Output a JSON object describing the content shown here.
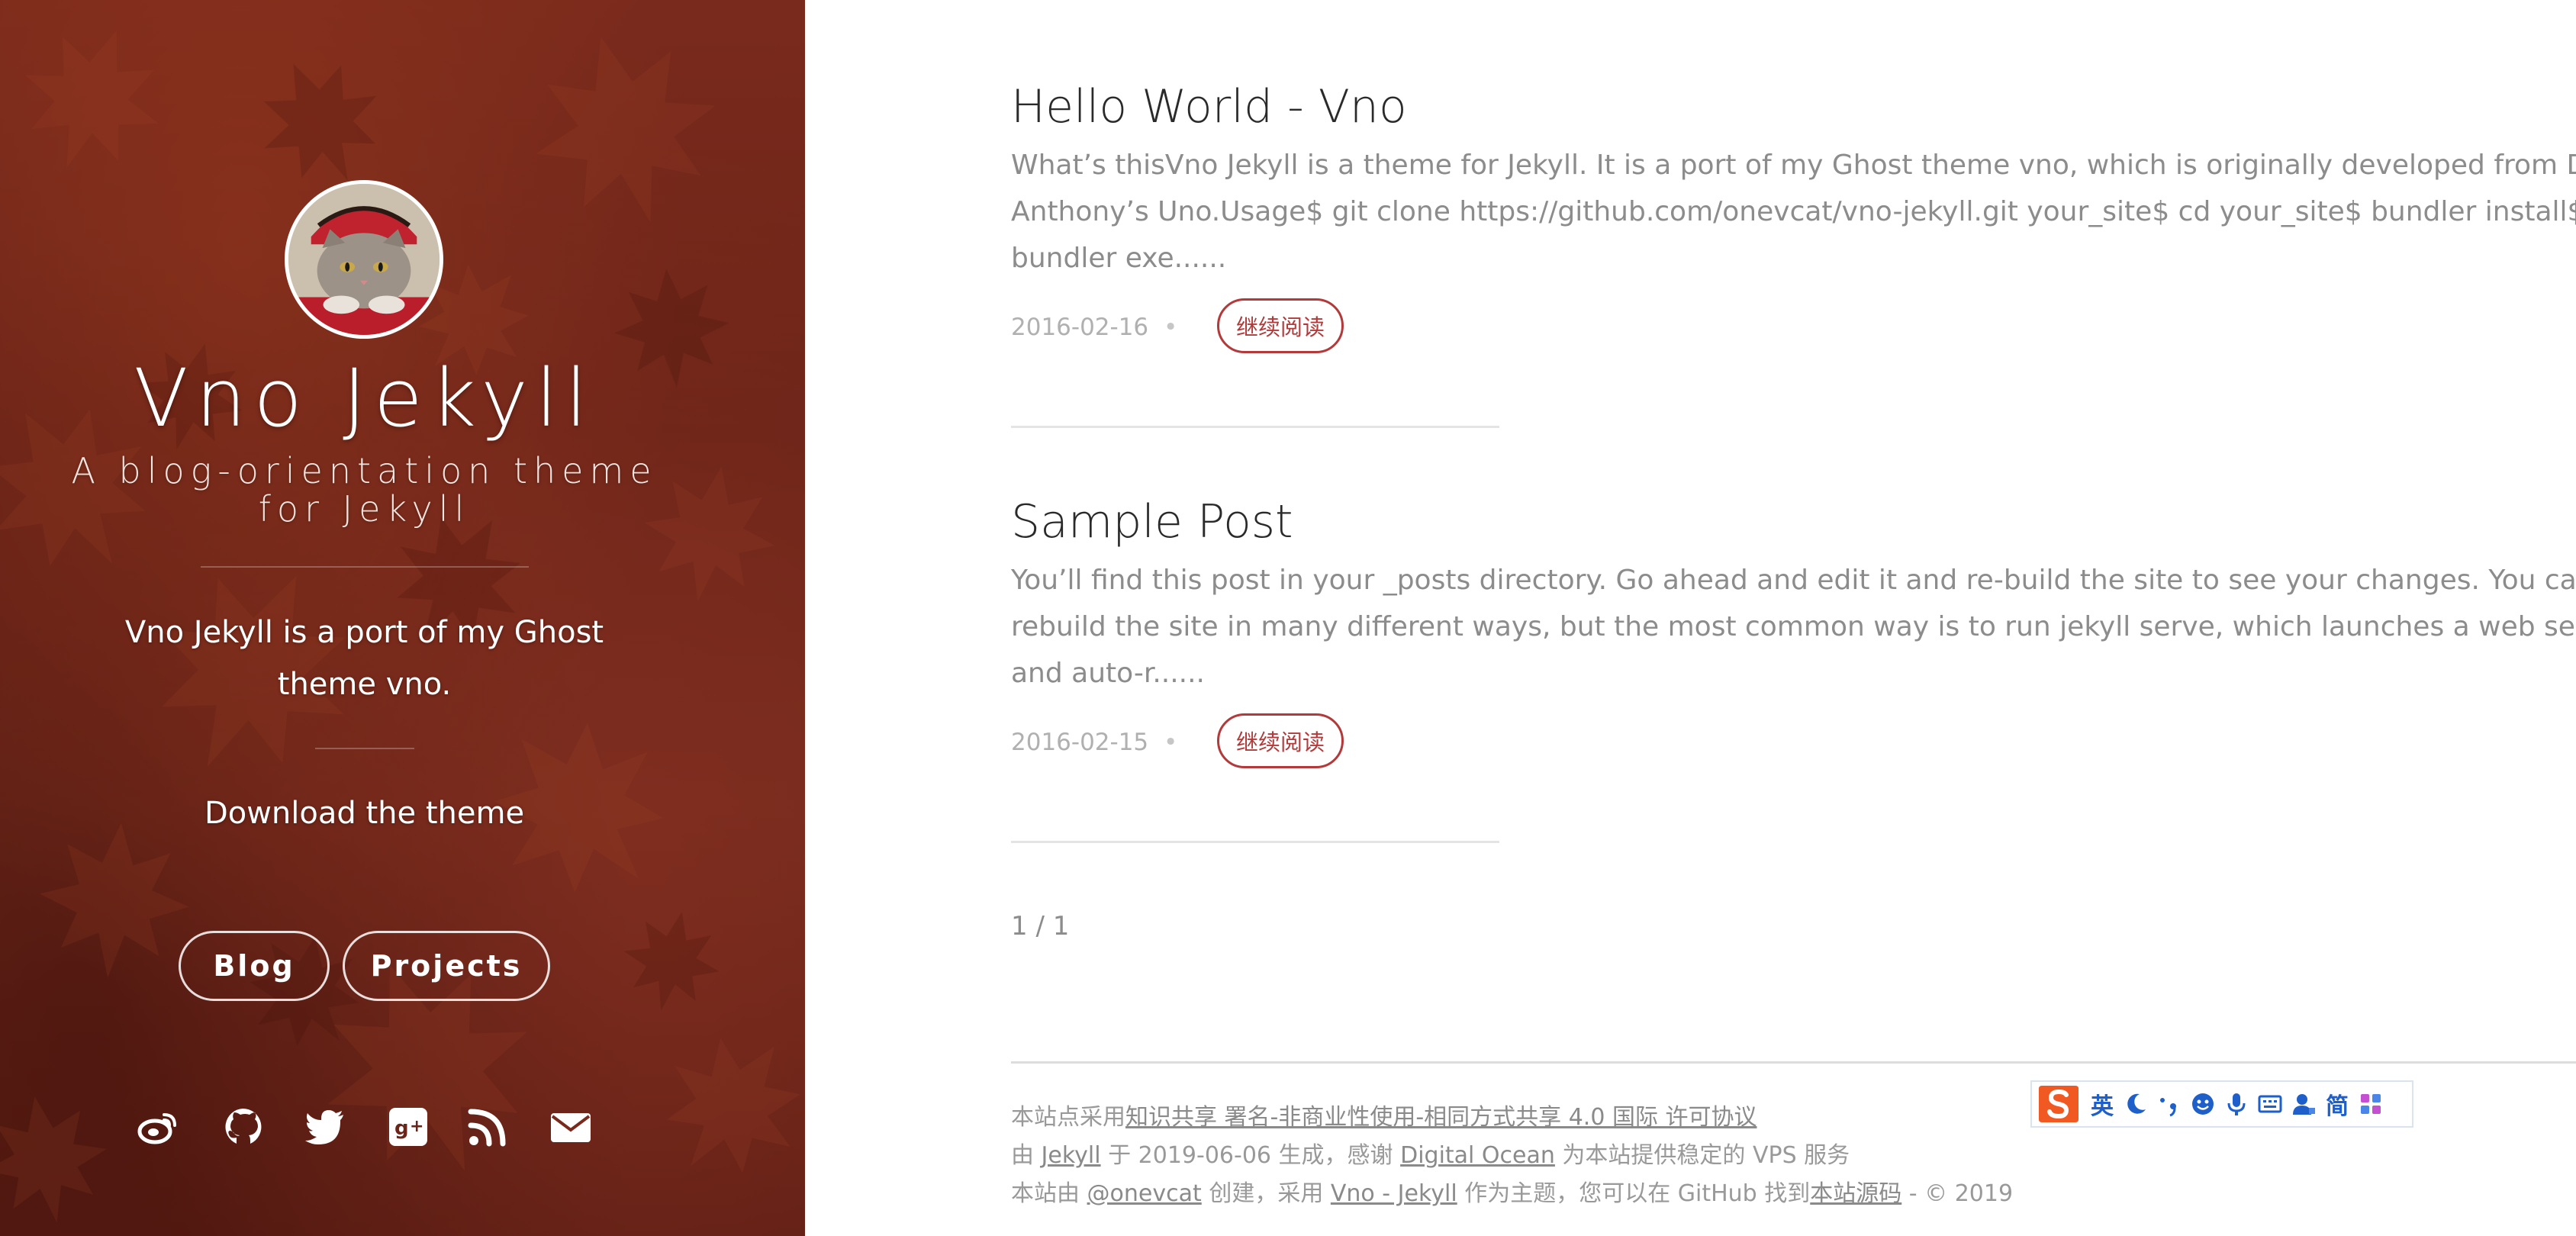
{
  "sidebar": {
    "title": "Vno Jekyll",
    "subtitle": "A blog-orientation theme for Jekyll",
    "description": "Vno Jekyll is a port of my Ghost theme vno.",
    "download_label": "Download the theme",
    "nav": [
      {
        "label": "Blog"
      },
      {
        "label": "Projects"
      }
    ],
    "social_icons": [
      "weibo-icon",
      "github-icon",
      "twitter-icon",
      "google-plus-icon",
      "rss-icon",
      "email-icon"
    ]
  },
  "posts": [
    {
      "title": "Hello World - Vno",
      "excerpt": "What’s thisVno Jekyll is a theme for Jekyll. It is a port of my Ghost theme vno, which is originally developed from Dale Anthony’s Uno.Usage$ git clone https://github.com/onevcat/vno-jekyll.git your_site$ cd your_site$ bundler install$ bundler exe......",
      "date": "2016-02-16",
      "read_more": "继续阅读"
    },
    {
      "title": "Sample Post",
      "excerpt": "You’ll find this post in your _posts directory. Go ahead and edit it and re-build the site to see your changes. You can rebuild the site in many different ways, but the most common way is to run jekyll serve, which launches a web server and auto-r......",
      "date": "2016-02-15",
      "read_more": "继续阅读"
    }
  ],
  "pagination": "1 / 1",
  "footer": {
    "line1_prefix": "本站点采用",
    "line1_link": "知识共享 署名-非商业性使用-相同方式共享 4.0 国际 许可协议",
    "line2_prefix": "由 ",
    "line2_link1": "Jekyll",
    "line2_mid": " 于 2019-06-06 生成，感谢 ",
    "line2_link2": "Digital Ocean",
    "line2_suffix": " 为本站提供稳定的 VPS 服务",
    "line3_prefix": "本站由 ",
    "line3_link1": "@onevcat",
    "line3_mid": " 创建，采用 ",
    "line3_link2": "Vno - Jekyll",
    "line3_mid2": " 作为主题，您可以在 GitHub 找到",
    "line3_link3": "本站源码",
    "line3_suffix": " - © 2019"
  },
  "ime_toolbar": {
    "lang_label": "英",
    "mode_label": "简",
    "icons": [
      "sogou-logo-icon",
      "moon-icon",
      "punctuation-icon",
      "emoji-icon",
      "microphone-icon",
      "keyboard-icon",
      "user-icon",
      "grid-icon"
    ]
  },
  "colors": {
    "sidebar_bg": "#6b2418",
    "accent": "#b23a3a",
    "text_muted": "#8c8c8c",
    "title_text": "#2a2a2a"
  }
}
